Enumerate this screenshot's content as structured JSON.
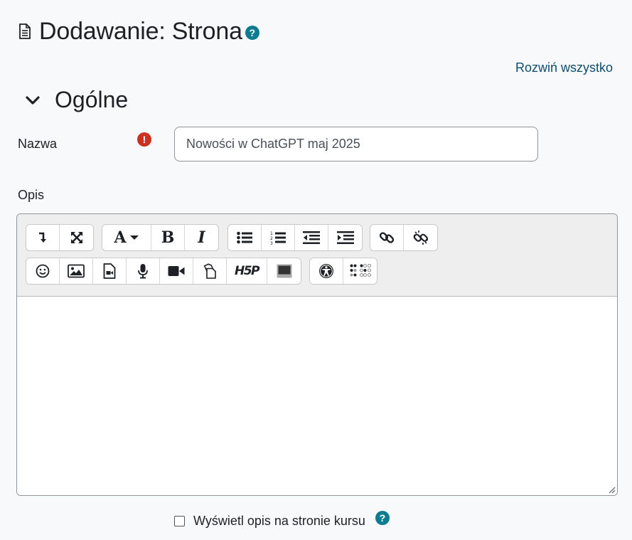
{
  "header": {
    "title": "Dodawanie: Strona",
    "icon": "page-icon",
    "help_icon": "question-circle-icon"
  },
  "expand_all_label": "Rozwiń wszystko",
  "section": {
    "title": "Ogólne",
    "chevron_icon": "chevron-down-icon"
  },
  "name_field": {
    "label": "Nazwa",
    "value": "Nowości w ChatGPT maj 2025",
    "required_icon": "exclamation-circle-icon"
  },
  "description_field": {
    "label": "Opis",
    "toolbar_row1": [
      [
        "collapse-toolbar-icon",
        "fullscreen-icon"
      ],
      [
        "font-style-icon",
        "bold-icon",
        "italic-icon"
      ],
      [
        "unordered-list-icon",
        "ordered-list-icon",
        "outdent-icon",
        "indent-icon"
      ],
      [
        "link-icon",
        "unlink-icon"
      ]
    ],
    "toolbar_row2": [
      [
        "emoji-icon",
        "image-icon",
        "media-icon",
        "record-audio-icon",
        "record-video-icon",
        "manage-files-icon",
        "h5p-icon",
        "background-color-icon"
      ],
      [
        "accessibility-checker-icon",
        "screenreader-helper-icon"
      ]
    ],
    "h5p_label": "H5P"
  },
  "show_description": {
    "label": "Wyświetl opis na stronie kursu",
    "checked": false,
    "help_icon": "question-circle-icon"
  },
  "colors": {
    "accent": "#0d7c90",
    "link": "#0f4c6e",
    "required": "#ca3120",
    "background": "#f8f9fa"
  }
}
